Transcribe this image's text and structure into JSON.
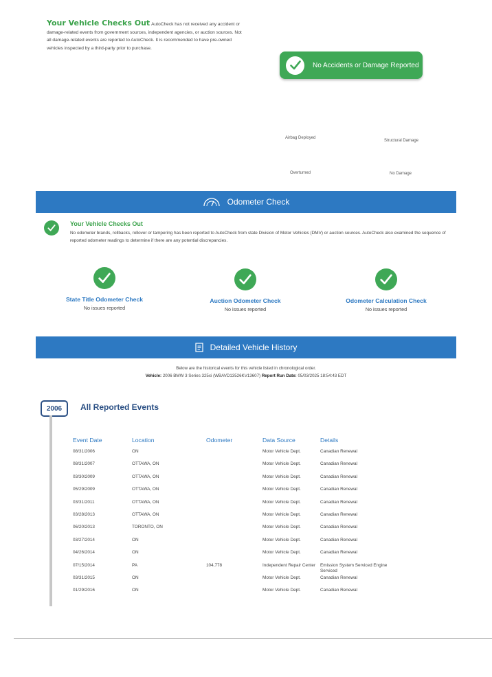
{
  "summary": {
    "title": "Your Vehicle Checks Out",
    "text": "AutoCheck has not received any accident or damage-related events from government sources, independent agencies, or auction sources. Not all damage-related events are reported to AutoCheck. It is recommended to have pre-owned vehicles inspected by a third-party prior to purchase."
  },
  "badge": {
    "label": "No Accidents or Damage Reported"
  },
  "damage_flags": [
    "Airbag Deployed",
    "Structural Damage",
    "Overturned",
    "No Damage"
  ],
  "odometer": {
    "header": "Odometer Check",
    "title": "Your Vehicle Checks Out",
    "text": "No odometer brands, rollbacks, rollover or tampering has been reported to AutoCheck from state Division of Motor Vehicles (DMV) or auction sources. AutoCheck also examined the sequence of reported odometer readings to determine if there are any potential discrepancies.",
    "checks": [
      {
        "label": "State Title Odometer Check",
        "result": "No issues reported"
      },
      {
        "label": "Auction Odometer Check",
        "result": "No issues reported"
      },
      {
        "label": "Odometer Calculation Check",
        "result": "No issues reported"
      }
    ]
  },
  "history": {
    "header": "Detailed Vehicle History",
    "intro": "Below are the historical events for this vehicle listed in chronological order.",
    "vehicle_label": "Vehicle:",
    "vehicle": "2006 BMW 3 Series 325xi (WBAVD13526KV13607)",
    "run_label": "Report Run Date:",
    "run_date": "05/03/2025 18:54:43 EDT"
  },
  "events": {
    "year": "2006",
    "title": "All Reported Events",
    "columns": [
      "Event Date",
      "Location",
      "Odometer",
      "Data Source",
      "Details"
    ],
    "rows": [
      [
        "08/31/2006",
        "ON",
        "",
        "Motor Vehicle Dept.",
        "Canadian Renewal"
      ],
      [
        "08/31/2007",
        "OTTAWA, ON",
        "",
        "Motor Vehicle Dept.",
        "Canadian Renewal"
      ],
      [
        "03/30/2009",
        "OTTAWA, ON",
        "",
        "Motor Vehicle Dept.",
        "Canadian Renewal"
      ],
      [
        "05/29/2009",
        "OTTAWA, ON",
        "",
        "Motor Vehicle Dept.",
        "Canadian Renewal"
      ],
      [
        "03/31/2011",
        "OTTAWA, ON",
        "",
        "Motor Vehicle Dept.",
        "Canadian Renewal"
      ],
      [
        "03/28/2013",
        "OTTAWA, ON",
        "",
        "Motor Vehicle Dept.",
        "Canadian Renewal"
      ],
      [
        "06/20/2013",
        "TORONTO, ON",
        "",
        "Motor Vehicle Dept.",
        "Canadian Renewal"
      ],
      [
        "03/27/2014",
        "ON",
        "",
        "Motor Vehicle Dept.",
        "Canadian Renewal"
      ],
      [
        "04/26/2014",
        "ON",
        "",
        "Motor Vehicle Dept.",
        "Canadian Renewal"
      ],
      [
        "07/15/2014",
        "PA",
        "104,778",
        "Independent Repair Center",
        "Emission System Serviced Engine Serviced"
      ],
      [
        "03/31/2015",
        "ON",
        "",
        "Motor Vehicle Dept.",
        "Canadian Renewal"
      ],
      [
        "01/29/2016",
        "ON",
        "",
        "Motor Vehicle Dept.",
        "Canadian Renewal"
      ]
    ]
  }
}
